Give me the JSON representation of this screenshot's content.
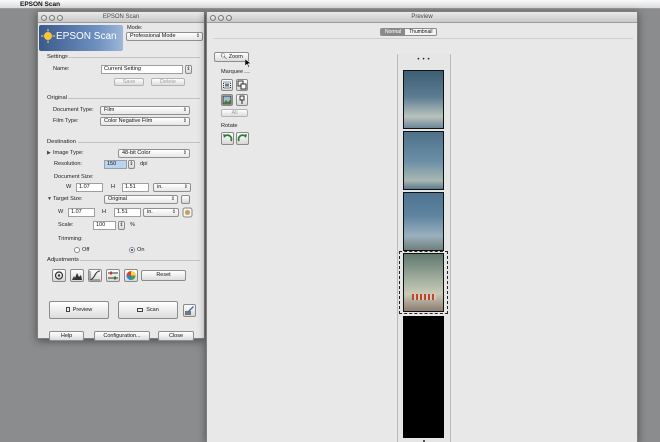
{
  "menubar": {
    "apple_glyph": "",
    "app_name": "EPSON Scan"
  },
  "scan_window": {
    "title": "EPSON Scan",
    "logo_text": "EPSON Scan",
    "mode_label": "Mode:",
    "mode_value": "Professional Mode",
    "settings": {
      "header": "Settings",
      "name_label": "Name:",
      "name_value": "Current Setting",
      "save_label": "Save",
      "delete_label": "Delete"
    },
    "original": {
      "header": "Original",
      "doc_type_label": "Document Type:",
      "doc_type_value": "Film",
      "film_type_label": "Film Type:",
      "film_type_value": "Color Negative Film"
    },
    "destination": {
      "header": "Destination",
      "image_type_label": "Image Type:",
      "image_type_value": "48-bit Color",
      "resolution_label": "Resolution:",
      "resolution_value": "150",
      "resolution_unit": "dpi",
      "doc_size_label": "Document Size:",
      "w_label": "W",
      "w_value": "1.07",
      "h_label": "H",
      "h_value": "1.51",
      "unit_value": "in.",
      "target_size_label": "Target Size:",
      "target_size_value": "Original",
      "tw_label": "W",
      "tw_value": "1.07",
      "th_label": "H",
      "th_value": "1.51",
      "tunit_value": "in.",
      "scale_label": "Scale:",
      "scale_value": "100",
      "scale_unit": "%",
      "trimming_label": "Trimming:",
      "trim_off_label": "Off",
      "trim_on_label": "On",
      "trimming_selected": "On"
    },
    "adjustments": {
      "header": "Adjustments",
      "reset_label": "Reset"
    },
    "preview_label": "Preview",
    "scan_label": "Scan",
    "help_label": "Help",
    "configuration_label": "Configuration...",
    "close_label": "Close"
  },
  "preview_window": {
    "title": "Preview",
    "tabs": [
      {
        "label": "Normal",
        "active": true
      },
      {
        "label": "Thumbnail",
        "active": false
      }
    ],
    "zoom_label": "Zoom",
    "marquee_label": "Marquee",
    "all_label": "All",
    "rotate_label": "Rotate",
    "film_frames": [
      {
        "label": "frame-1",
        "color": "#4f7188"
      },
      {
        "label": "frame-2",
        "color": "#5a7a90"
      },
      {
        "label": "frame-3",
        "color": "#4c6f8a"
      },
      {
        "label": "frame-4",
        "color": "#7d8e7c"
      },
      {
        "label": "frame-5",
        "color": "#000000"
      }
    ]
  },
  "colors": {
    "desktop": "#8b8c8e",
    "window_bg": "#e8e8e8",
    "accent": "#1f4f9a",
    "highlight": "#b7d4f0"
  }
}
